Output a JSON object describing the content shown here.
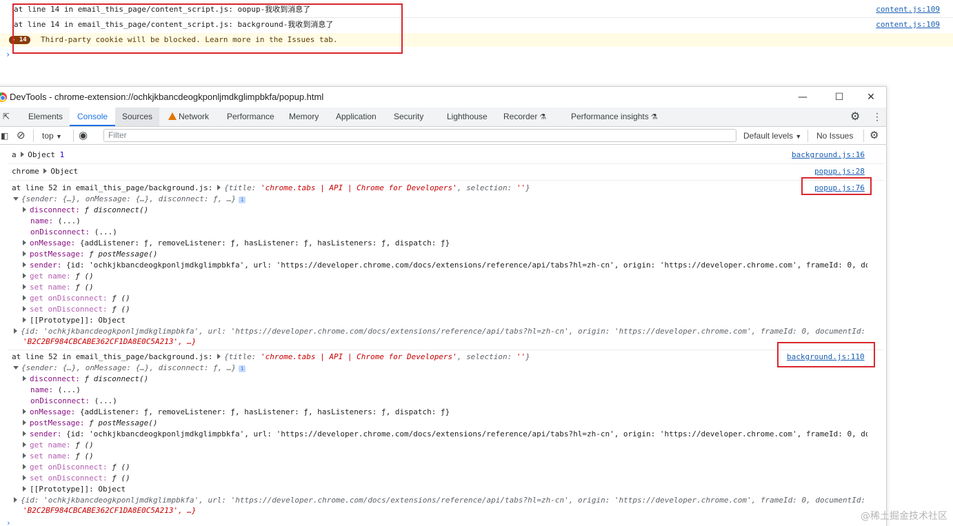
{
  "bg_console": {
    "lines": [
      {
        "text": "at line 14 in email_this_page/content_script.js: oopup-我收到消息了",
        "source": "content.js:109"
      },
      {
        "text": "at line 14 in email_this_page/content_script.js: background-我收到消息了",
        "source": "content.js:109"
      }
    ],
    "warning": {
      "count": "14",
      "text": "Third-party cookie will be blocked. Learn more in the Issues tab."
    },
    "prompt": "›"
  },
  "devtools": {
    "title": "DevTools - chrome-extension://ochkjkbancdeogkponljmdkglimpbkfa/popup.html",
    "window_buttons": {
      "minimize": "—",
      "maximize": "☐",
      "close": "✕"
    },
    "tabs": [
      "Elements",
      "Console",
      "Sources",
      "Network",
      "Performance",
      "Memory",
      "Application",
      "Security",
      "Lighthouse",
      "Recorder",
      "Performance insights"
    ],
    "active_tab": "Console",
    "toolbar": {
      "context": "top",
      "filter_placeholder": "Filter",
      "levels": "Default levels",
      "issues": "No Issues"
    }
  },
  "console": {
    "r1": {
      "label": "a",
      "obj": "Object",
      "count": "1",
      "source": "background.js:16"
    },
    "r2": {
      "label": "chrome",
      "obj": "Object",
      "source": "popup.js:28"
    },
    "groups": [
      {
        "prefix": "at line 52 in email_this_page/background.js:",
        "title_key": "title:",
        "title_val": "'chrome.tabs  |  API  |  Chrome for Developers'",
        "selection_key": "selection:",
        "selection_val": "''",
        "source": "popup.js:76",
        "summary": "{sender: {…}, onMessage: {…}, disconnect: ƒ, …}",
        "disconnect": "ƒ disconnect()",
        "name": "(...)",
        "onDisconnect": "(...)",
        "onMessage": "{addListener: ƒ, removeListener: ƒ, hasListener: ƒ, hasListeners: ƒ, dispatch: ƒ}",
        "postMessage": "ƒ postMessage()",
        "sender": "{id: 'ochkjkbancdeogkponljmdkglimpbkfa', url: 'https://developer.chrome.com/docs/extensions/reference/api/tabs?hl=zh-cn', origin: 'https://developer.chrome.com', frameId: 0, doc",
        "getter": "ƒ ()",
        "proto": "Object",
        "sender_full_1": "{id: 'ochkjkbancdeogkponljmdkglimpbkfa', url: 'https://developer.chrome.com/docs/extensions/reference/api/tabs?hl=zh-cn', origin: 'https://developer.chrome.com', frameId: 0, documentId:",
        "sender_full_2": "'B2C2BF984CBCABE362CF1DA8E0C5A213', …}"
      },
      {
        "prefix": "at line 52 in email_this_page/background.js:",
        "title_key": "title:",
        "title_val": "'chrome.tabs  |  API  |  Chrome for Developers'",
        "selection_key": "selection:",
        "selection_val": "''",
        "source": "background.js:110",
        "summary": "{sender: {…}, onMessage: {…}, disconnect: ƒ, …}",
        "disconnect": "ƒ disconnect()",
        "name": "(...)",
        "onDisconnect": "(...)",
        "onMessage": "{addListener: ƒ, removeListener: ƒ, hasListener: ƒ, hasListeners: ƒ, dispatch: ƒ}",
        "postMessage": "ƒ postMessage()",
        "sender": "{id: 'ochkjkbancdeogkponljmdkglimpbkfa', url: 'https://developer.chrome.com/docs/extensions/reference/api/tabs?hl=zh-cn', origin: 'https://developer.chrome.com', frameId: 0, do",
        "getter": "ƒ ()",
        "proto": "Object",
        "sender_full_1": "{id: 'ochkjkbancdeogkponljmdkglimpbkfa', url: 'https://developer.chrome.com/docs/extensions/reference/api/tabs?hl=zh-cn', origin: 'https://developer.chrome.com', frameId: 0, documentId:",
        "sender_full_2": "'B2C2BF984CBCABE362CF1DA8E0C5A213', …}"
      }
    ],
    "keys": {
      "disconnect": "disconnect:",
      "name": "name:",
      "onDisconnect": "onDisconnect:",
      "onMessage": "onMessage:",
      "postMessage": "postMessage:",
      "sender": "sender:",
      "get_name": "get name:",
      "set_name": "set name:",
      "get_onDisconnect": "get onDisconnect:",
      "set_onDisconnect": "set onDisconnect:",
      "prototype": "[[Prototype]]:"
    },
    "prompt": "›"
  },
  "watermark": "@稀土掘金技术社区",
  "colors": {
    "accent": "#1a73e8",
    "highlight": "#d8262d",
    "warning_bg": "#fffbe5"
  }
}
